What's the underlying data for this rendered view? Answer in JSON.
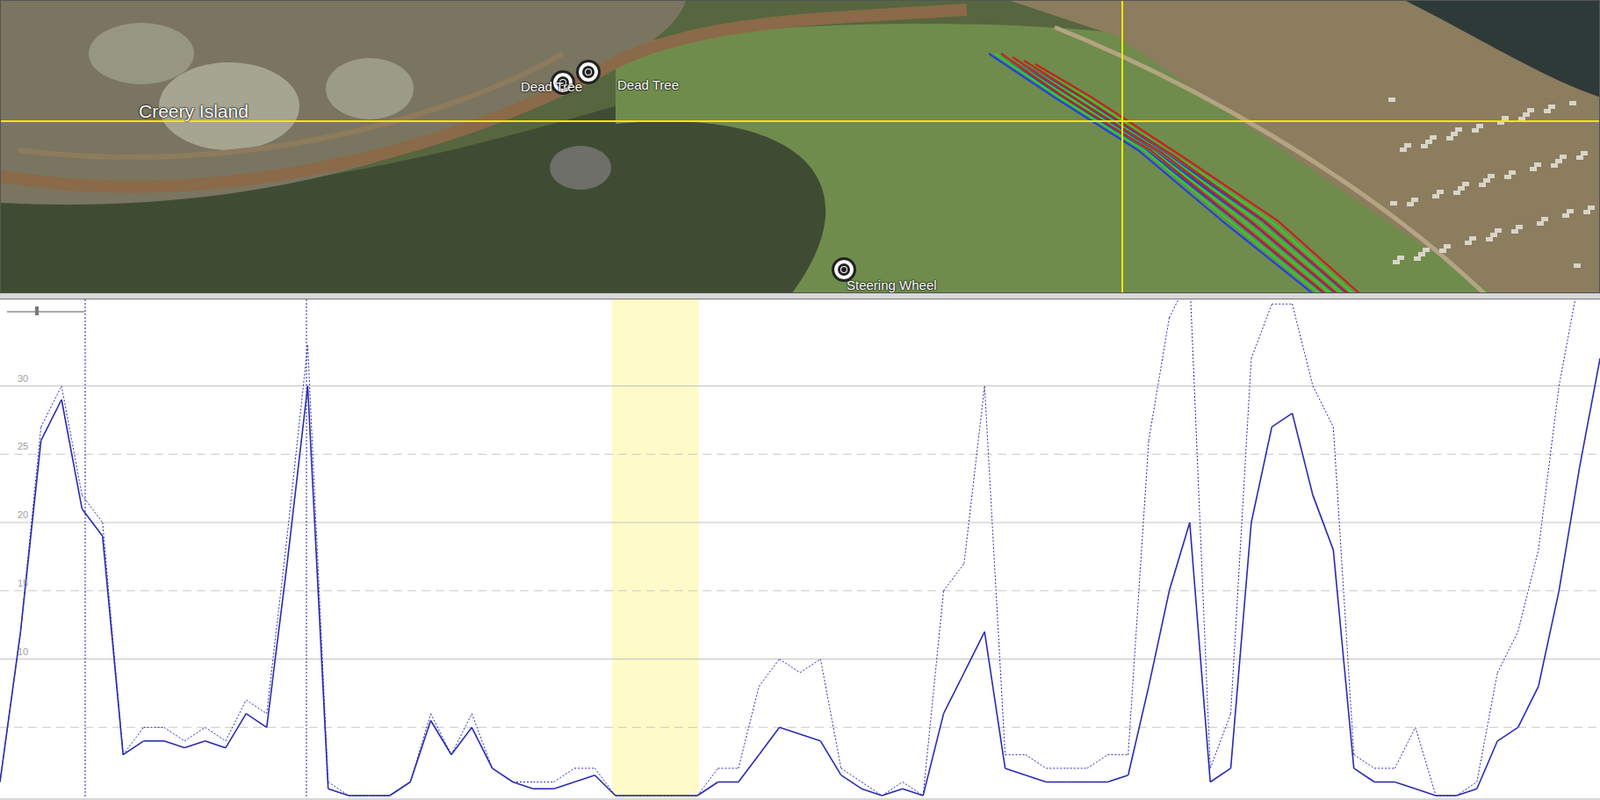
{
  "map": {
    "labels": [
      {
        "text": "Creery Island",
        "kind": "area"
      },
      {
        "text": "Dead Tree",
        "kind": "waypoint"
      },
      {
        "text": "Dead Tree",
        "kind": "waypoint"
      },
      {
        "text": "Steering Wheel",
        "kind": "waypoint"
      }
    ],
    "tracks": [
      {
        "color": "#1a3fe0"
      },
      {
        "color": "#2bd12b"
      },
      {
        "color": "#c81e1e"
      }
    ]
  },
  "chart": {
    "y_ticks": [
      "30",
      "25",
      "20",
      "15",
      "10"
    ],
    "series": [
      {
        "kind": "solid",
        "values": [
          1,
          12,
          26,
          29,
          21,
          19,
          3,
          4,
          4,
          3.5,
          4,
          3.5,
          6,
          5,
          17,
          30,
          0.5,
          0,
          0,
          0,
          1,
          5.5,
          3,
          5,
          2,
          1,
          0.5,
          0.5,
          1,
          1.5,
          0,
          0,
          0,
          0,
          0,
          1,
          1,
          3,
          5,
          4.5,
          4,
          1.5,
          0.5,
          0,
          0.5,
          0,
          6,
          9,
          12,
          2,
          1.5,
          1,
          1,
          1,
          1,
          1.5,
          8,
          15,
          20,
          1,
          2,
          20,
          27,
          28,
          22,
          18,
          2,
          1,
          1,
          0.5,
          0,
          0,
          0.5,
          4,
          5,
          8,
          15,
          24,
          32
        ]
      },
      {
        "kind": "dotted",
        "values": [
          1,
          12,
          27,
          30,
          22,
          20,
          3,
          5,
          5,
          4,
          5,
          4,
          7,
          6,
          19,
          33,
          1,
          0,
          0,
          0,
          1,
          6,
          3,
          6,
          2,
          1,
          1,
          1,
          2,
          2,
          0,
          0,
          0,
          0,
          0,
          2,
          2,
          8,
          10,
          9,
          10,
          2,
          1,
          0,
          1,
          0,
          15,
          17,
          30,
          3,
          3,
          2,
          2,
          2,
          3,
          3,
          26,
          35,
          38,
          2,
          6,
          32,
          36,
          36,
          30,
          27,
          3,
          2,
          2,
          5,
          0,
          0,
          1,
          9,
          12,
          18,
          30,
          38,
          40
        ]
      }
    ]
  }
}
